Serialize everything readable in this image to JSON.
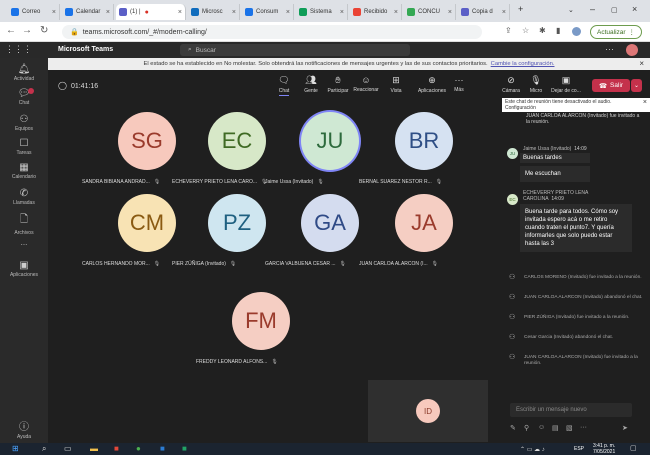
{
  "browser": {
    "tabs": [
      {
        "label": "Correo",
        "color": "#1a73e8"
      },
      {
        "label": "Calendar",
        "color": "#1a73e8"
      },
      {
        "label": "(1) |",
        "color": "#5b5fc7"
      },
      {
        "label": "Microsc",
        "color": "#0f6cbd"
      },
      {
        "label": "Consum",
        "color": "#1a73e8"
      },
      {
        "label": "Sistema",
        "color": "#0f9d58"
      },
      {
        "label": "Recibido",
        "color": "#ea4335"
      },
      {
        "label": "CONCU",
        "color": "#34a853"
      },
      {
        "label": "Copia d",
        "color": "#5b5fc7"
      }
    ],
    "url": "teams.microsoft.com/_#/modern-calling/",
    "update_label": "Actualizar"
  },
  "teams": {
    "title": "Microsoft Teams",
    "search_placeholder": "Buscar",
    "notification": "El estado se ha establecido en No molestar. Solo obtendrá las notificaciones de mensajes urgentes y las de sus contactos prioritarios.",
    "notification_link": "Cambie la configuración."
  },
  "rail": [
    {
      "label": "Actividad",
      "icon": "bell-icon"
    },
    {
      "label": "Chat",
      "icon": "chat-icon"
    },
    {
      "label": "Equipos",
      "icon": "teams-icon"
    },
    {
      "label": "Tareas",
      "icon": "tasks-icon"
    },
    {
      "label": "Calendario",
      "icon": "calendar-icon"
    },
    {
      "label": "Llamadas",
      "icon": "phone-icon"
    },
    {
      "label": "Archivos",
      "icon": "files-icon"
    },
    {
      "label": "...",
      "icon": "more-icon"
    },
    {
      "label": "Aplicaciones",
      "icon": "apps-icon"
    },
    {
      "label": "Ayuda",
      "icon": "help-icon"
    }
  ],
  "meeting": {
    "timer": "01:41:16",
    "controls": [
      "Chat",
      "Gente",
      "Participar",
      "Reaccionar",
      "Vista",
      "Aplicaciones",
      "Más"
    ],
    "right_controls": [
      "Cámara",
      "Micro",
      "Dejar de co..."
    ],
    "hangup_label": "Salir",
    "self_initials": "ID"
  },
  "participants": [
    {
      "initials": "SG",
      "name": "SANDRA BIBIANA ANDRAD...",
      "bg": "#f7c9bd",
      "fg": "#9a3b2c"
    },
    {
      "initials": "EC",
      "name": "ECHEVERRY PRIETO LENA CARO...",
      "bg": "#d7e8c8",
      "fg": "#3f6a24"
    },
    {
      "initials": "JU",
      "name": "Jaime Ussa (Invitado)",
      "bg": "#cfe8d3",
      "fg": "#2d6a3c",
      "speaking": true
    },
    {
      "initials": "BR",
      "name": "BERNAL SUAREZ NESTOR R...",
      "bg": "#d6e2f2",
      "fg": "#2f4f86"
    },
    {
      "initials": "CM",
      "name": "CARLOS HERNANDO MOR...",
      "bg": "#f8e3b4",
      "fg": "#8a5a12"
    },
    {
      "initials": "PZ",
      "name": "PIER ZÚÑIGA (Invitado)",
      "bg": "#cfe6f0",
      "fg": "#1f6080"
    },
    {
      "initials": "GA",
      "name": "GARCIA VALBUENA CESAR ...",
      "bg": "#d4dcef",
      "fg": "#2f4a86"
    },
    {
      "initials": "JA",
      "name": "JUAN CARLOA ALARCON (I...",
      "bg": "#f5cec3",
      "fg": "#9a3b2c"
    },
    {
      "initials": "FM",
      "name": "FREDDY LEONARD ALFONS...",
      "bg": "#f5cec3",
      "fg": "#9a3b2c"
    }
  ],
  "chat": {
    "tooltip": "Este chat de reunión tiene desactivado el audio. Configuración",
    "top_event": "JUAN CARLOA ALARCON (Invitado) fue invitado a la reunión.",
    "msg1_author": "Jaime Ussa (Invitado)",
    "msg1_time": "14:09",
    "msg1_text": "Buenas tardes",
    "msg1_avatar": "JU",
    "msg2_text": "Me escuchan",
    "msg3_author": "ECHEVERRY PRIETO LENA CAROLINA",
    "msg3_time": "14:09",
    "msg3_avatar": "EC",
    "msg3_text": "Buena tarde para todos. Cómo soy invitada espero acá o me retiro cuando traten el punto7. Y quería informarles que solo puedo estar hasta las 3",
    "events": [
      "CARLOS MORENO (Invitado) fue invitado a la reunión.",
      "JUAN CARLOA ALARCON (Invitado) abandonó el chat.",
      "PIER ZÚÑIGA (Invitado) fue invitado a la reunión.",
      "Cesar Garcia (Invitado) abandonó el chat.",
      "JUAN CARLOA ALARCON (Invitado) fue invitado a la reunión."
    ],
    "compose_placeholder": "Escribir un mensaje nuevo"
  },
  "taskbar": {
    "lang": "ESP",
    "time": "3:41 p. m.",
    "date": "7/05/2021"
  }
}
